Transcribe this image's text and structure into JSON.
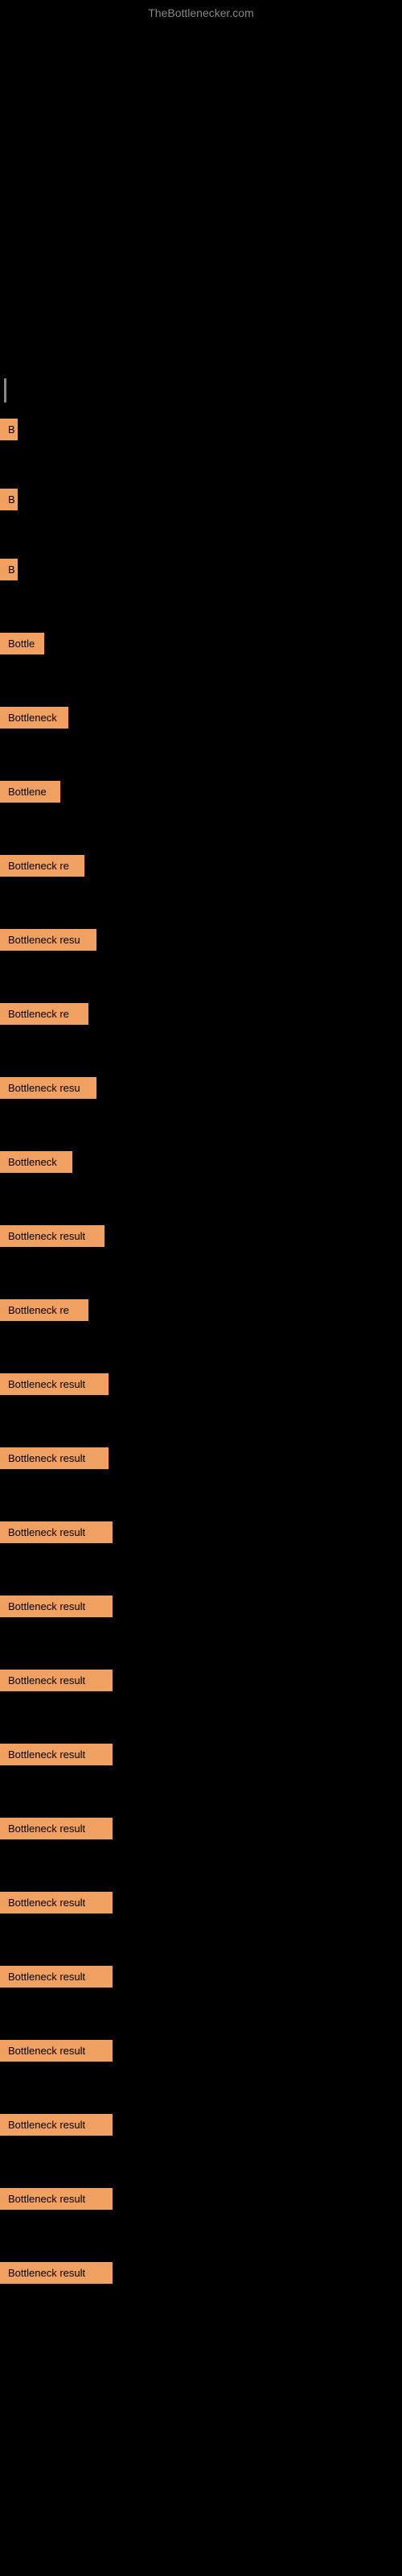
{
  "site": {
    "title": "TheBottlenecker.com"
  },
  "items": [
    {
      "id": 1,
      "label": "B",
      "class": "item-1"
    },
    {
      "id": 2,
      "label": "B",
      "class": "item-2"
    },
    {
      "id": 3,
      "label": "B",
      "class": "item-3"
    },
    {
      "id": 4,
      "label": "Bottle",
      "class": "item-4"
    },
    {
      "id": 5,
      "label": "Bottleneck",
      "class": "item-5"
    },
    {
      "id": 6,
      "label": "Bottlene",
      "class": "item-6"
    },
    {
      "id": 7,
      "label": "Bottleneck re",
      "class": "item-7"
    },
    {
      "id": 8,
      "label": "Bottleneck resu",
      "class": "item-8"
    },
    {
      "id": 9,
      "label": "Bottleneck re",
      "class": "item-9"
    },
    {
      "id": 10,
      "label": "Bottleneck resu",
      "class": "item-10"
    },
    {
      "id": 11,
      "label": "Bottleneck",
      "class": "item-11"
    },
    {
      "id": 12,
      "label": "Bottleneck result",
      "class": "item-12"
    },
    {
      "id": 13,
      "label": "Bottleneck re",
      "class": "item-13"
    },
    {
      "id": 14,
      "label": "Bottleneck result",
      "class": "item-14"
    },
    {
      "id": 15,
      "label": "Bottleneck result",
      "class": "item-15"
    },
    {
      "id": 16,
      "label": "Bottleneck result",
      "class": "item-16"
    },
    {
      "id": 17,
      "label": "Bottleneck result",
      "class": "item-17"
    },
    {
      "id": 18,
      "label": "Bottleneck result",
      "class": "item-18"
    },
    {
      "id": 19,
      "label": "Bottleneck result",
      "class": "item-19"
    },
    {
      "id": 20,
      "label": "Bottleneck result",
      "class": "item-20"
    },
    {
      "id": 21,
      "label": "Bottleneck result",
      "class": "item-21"
    },
    {
      "id": 22,
      "label": "Bottleneck result",
      "class": "item-22"
    },
    {
      "id": 23,
      "label": "Bottleneck result",
      "class": "item-23"
    },
    {
      "id": 24,
      "label": "Bottleneck result",
      "class": "item-24"
    },
    {
      "id": 25,
      "label": "Bottleneck result",
      "class": "item-25"
    },
    {
      "id": 26,
      "label": "Bottleneck result",
      "class": "item-26"
    }
  ]
}
